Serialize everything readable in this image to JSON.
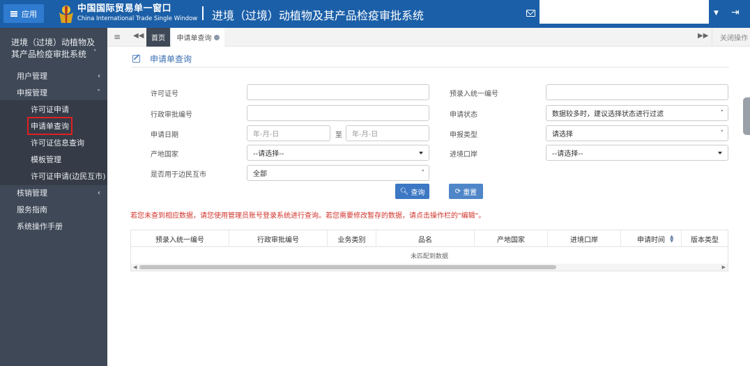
{
  "header": {
    "app_button": "应用",
    "brand_cn": "中国国际贸易单一窗口",
    "brand_en": "China International Trade Single Window",
    "system_title": "进境（过境）动植物及其产品检疫审批系统",
    "colors": {
      "header_bg": "#1b5fa8",
      "sidebar_bg": "#3f4856",
      "highlight": "#e02020"
    }
  },
  "sidebar": {
    "system_name": "进境（过境）动植物及其产品检疫审批系统",
    "menu": {
      "user_mgmt": "用户管理",
      "declare_mgmt": "申报管理",
      "verify_mgmt": "核销管理",
      "service_guide": "服务指南",
      "manual": "系统操作手册"
    },
    "sub": {
      "permit_apply": "许可证申请",
      "apply_query": "申请单查询",
      "permit_info": "许可证信息查询",
      "template": "模板管理",
      "permit_border": "许可证申请(边民互市)"
    }
  },
  "tabs": {
    "home": "首页",
    "current": "申请单查询",
    "close_ops": "关闭操作"
  },
  "page": {
    "title": "申请单查询"
  },
  "form": {
    "permit_no": {
      "label": "许可证号",
      "value": ""
    },
    "pre_entry_no": {
      "label": "预录入统一编号",
      "value": ""
    },
    "admin_no": {
      "label": "行政审批编号",
      "value": ""
    },
    "apply_status": {
      "label": "申请状态",
      "value": "数据较多时，建议选择状态进行过滤"
    },
    "apply_date": {
      "label": "申请日期",
      "from_placeholder": "年-月-日",
      "to": "至",
      "to_placeholder": "年-月-日"
    },
    "declare_type": {
      "label": "申报类型",
      "value": "请选择"
    },
    "origin_country": {
      "label": "产地国家",
      "value": "--请选择--"
    },
    "entry_port": {
      "label": "进境口岸",
      "value": "--请选择--"
    },
    "border_trade": {
      "label": "是否用于边民互市",
      "value": "全部"
    },
    "search_button": "查询",
    "reset_button": "重置"
  },
  "notice": "若您未查到相应数据，请您使用管理员账号登录系统进行查询。若您需要修改暂存的数据，请点击操作栏的\"编辑\"。",
  "table": {
    "columns": [
      "预录入统一编号",
      "行政审批编号",
      "业务类别",
      "品名",
      "产地国家",
      "进境口岸",
      "申请时间",
      "版本类型"
    ],
    "empty_text": "未匹配到数据"
  }
}
